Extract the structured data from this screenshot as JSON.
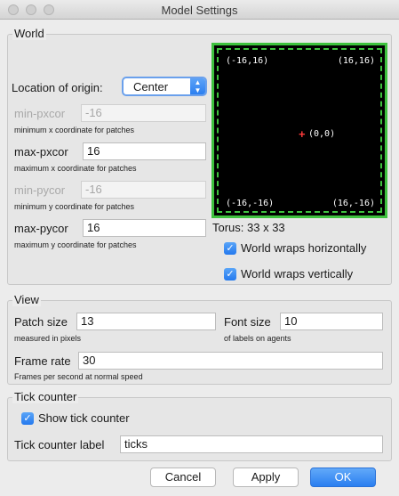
{
  "window": {
    "title": "Model Settings"
  },
  "world": {
    "group_title": "World",
    "origin_label": "Location of origin:",
    "origin_value": "Center",
    "min_pxcor": {
      "label": "min-pxcor",
      "value": "-16",
      "hint": "minimum x coordinate for patches"
    },
    "max_pxcor": {
      "label": "max-pxcor",
      "value": "16",
      "hint": "maximum x coordinate for patches"
    },
    "min_pycor": {
      "label": "min-pycor",
      "value": "-16",
      "hint": "minimum y coordinate for patches"
    },
    "max_pycor": {
      "label": "max-pycor",
      "value": "16",
      "hint": "maximum y coordinate for patches"
    },
    "preview": {
      "top_left": "(-16,16)",
      "top_right": "(16,16)",
      "center": "(0,0)",
      "bottom_left": "(-16,-16)",
      "bottom_right": "(16,-16)",
      "border_color": "#3ec13e",
      "origin_color": "#ff3b3b"
    },
    "torus_label": "Torus: 33 x 33",
    "wrap_h": {
      "label": "World wraps horizontally",
      "checked": true
    },
    "wrap_v": {
      "label": "World wraps vertically",
      "checked": true
    }
  },
  "view": {
    "group_title": "View",
    "patch_size": {
      "label": "Patch size",
      "value": "13",
      "hint": "measured in pixels"
    },
    "font_size": {
      "label": "Font size",
      "value": "10",
      "hint": "of labels on agents"
    },
    "frame_rate": {
      "label": "Frame rate",
      "value": "30",
      "hint": "Frames per second at normal speed"
    }
  },
  "tick_counter": {
    "group_title": "Tick counter",
    "show": {
      "label": "Show tick counter",
      "checked": true
    },
    "label_label": "Tick counter label",
    "label_value": "ticks"
  },
  "buttons": {
    "cancel": "Cancel",
    "apply": "Apply",
    "ok": "OK"
  },
  "colors": {
    "accent": "#2a7ff0"
  }
}
